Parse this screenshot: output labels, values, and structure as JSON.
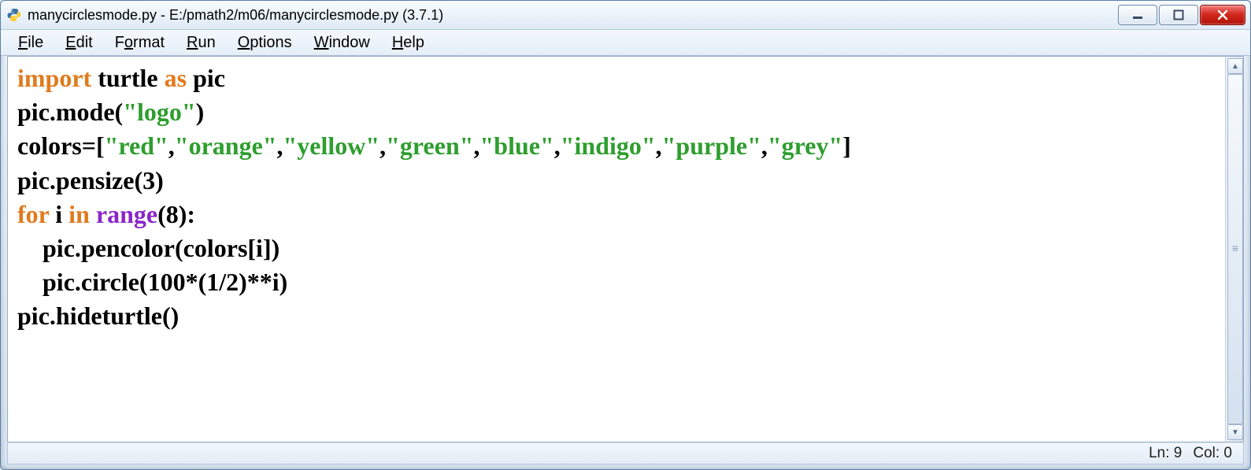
{
  "title": "manycirclesmode.py - E:/pmath2/m06/manycirclesmode.py (3.7.1)",
  "menu": {
    "file": "File",
    "edit": "Edit",
    "format": "Format",
    "run": "Run",
    "options": "Options",
    "window": "Window",
    "help": "Help"
  },
  "code": {
    "kw_import": "import",
    "kw_as": "as",
    "kw_for": "for",
    "kw_in": "in",
    "id_turtle": " turtle ",
    "id_pic": " pic",
    "l2a": "pic.mode(",
    "l2s": "\"logo\"",
    "l2b": ")",
    "l3a": "colors=[",
    "l3s": "\"red\"",
    "l3c1": ",",
    "l3s2": "\"orange\"",
    "l3c2": ",",
    "l3s3": "\"yellow\"",
    "l3c3": ",",
    "l3s4": "\"green\"",
    "l3c4": ",",
    "l3s5": "\"blue\"",
    "l3c5": ",",
    "l3s6": "\"indigo\"",
    "l3c6": ",",
    "l3s7": "\"purple\"",
    "l3c7": ",",
    "l3s8": "\"grey\"",
    "l3b": "]",
    "l4": "pic.pensize(3)",
    "l5a": " i ",
    "l5b": " range",
    "l5c": "(8):",
    "l6": "    pic.pencolor(colors[i])",
    "l7": "    pic.circle(100*(1/2)**i)",
    "l8": "pic.hideturtle()"
  },
  "status": {
    "ln": "Ln: 9",
    "col": "Col: 0"
  }
}
